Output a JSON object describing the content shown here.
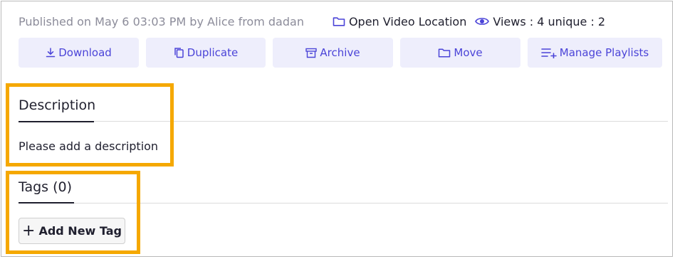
{
  "meta": {
    "published": "Published on May 6 03:03 PM by Alice from dadan",
    "open_location_label": "Open Video Location",
    "views_label": "Views : 4 unique : 2"
  },
  "actions": {
    "download": "Download",
    "duplicate": "Duplicate",
    "archive": "Archive",
    "move": "Move",
    "manage_playlists": "Manage Playlists"
  },
  "description": {
    "title": "Description",
    "text": "Please add a description"
  },
  "tags": {
    "title": "Tags (0)",
    "add_button": "Add New Tag"
  },
  "colors": {
    "accent": "#4b44d8",
    "button_bg": "#eeeefc",
    "highlight": "#f5a800",
    "muted_text": "#8c8c9a"
  },
  "icons": [
    "folder-icon",
    "eye-icon",
    "download-icon",
    "duplicate-icon",
    "archive-icon",
    "folder-icon",
    "playlist-add-icon",
    "plus-icon"
  ]
}
